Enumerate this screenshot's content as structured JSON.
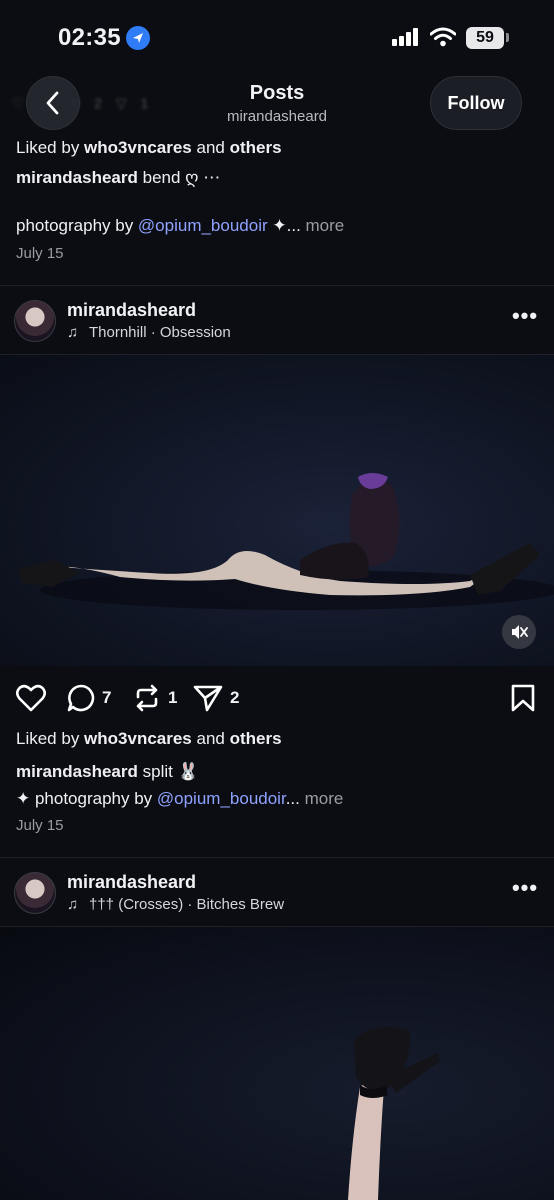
{
  "status_bar": {
    "time": "02:35",
    "battery": "59",
    "icons": [
      "location-arrow-icon",
      "cellular-signal-icon",
      "wifi-icon",
      "battery-icon"
    ]
  },
  "nav": {
    "title": "Posts",
    "subtitle": "mirandasheard",
    "follow_label": "Follow",
    "ghost_counts": [
      "2",
      "1"
    ]
  },
  "previous_post": {
    "liked_by_prefix": "Liked by ",
    "liked_by_user": "who3vncares",
    "liked_by_and": " and ",
    "liked_by_others": "others",
    "caption_user": "mirandasheard",
    "caption_text": " bend ღ ⋯",
    "caption_line2_prefix": "photography by ",
    "caption_line2_mention": "@opium_boudoir",
    "caption_line2_suffix": " ✦...",
    "more_label": " more",
    "date": "July 15"
  },
  "post": {
    "username": "mirandasheard",
    "song": "Thornhill · Obsession",
    "likes_prefix": "Liked by ",
    "liked_by_user": "who3vncares",
    "liked_by_and": " and ",
    "liked_by_others": "others",
    "comments": "7",
    "reposts": "1",
    "shares": "2",
    "caption_user": "mirandasheard",
    "caption_text": " split 🐰",
    "caption_line2_prefix": "✦ photography by ",
    "caption_line2_mention": "@opium_boudoir",
    "caption_line2_suffix": "...",
    "more_label": " more",
    "date": "July 15"
  },
  "next_post": {
    "username": "mirandasheard",
    "song": "††† (Crosses) · Bitches Brew"
  },
  "colors": {
    "background": "#0b0d12",
    "mention": "#8fa2ff",
    "location_accent": "#2f7cf6"
  }
}
